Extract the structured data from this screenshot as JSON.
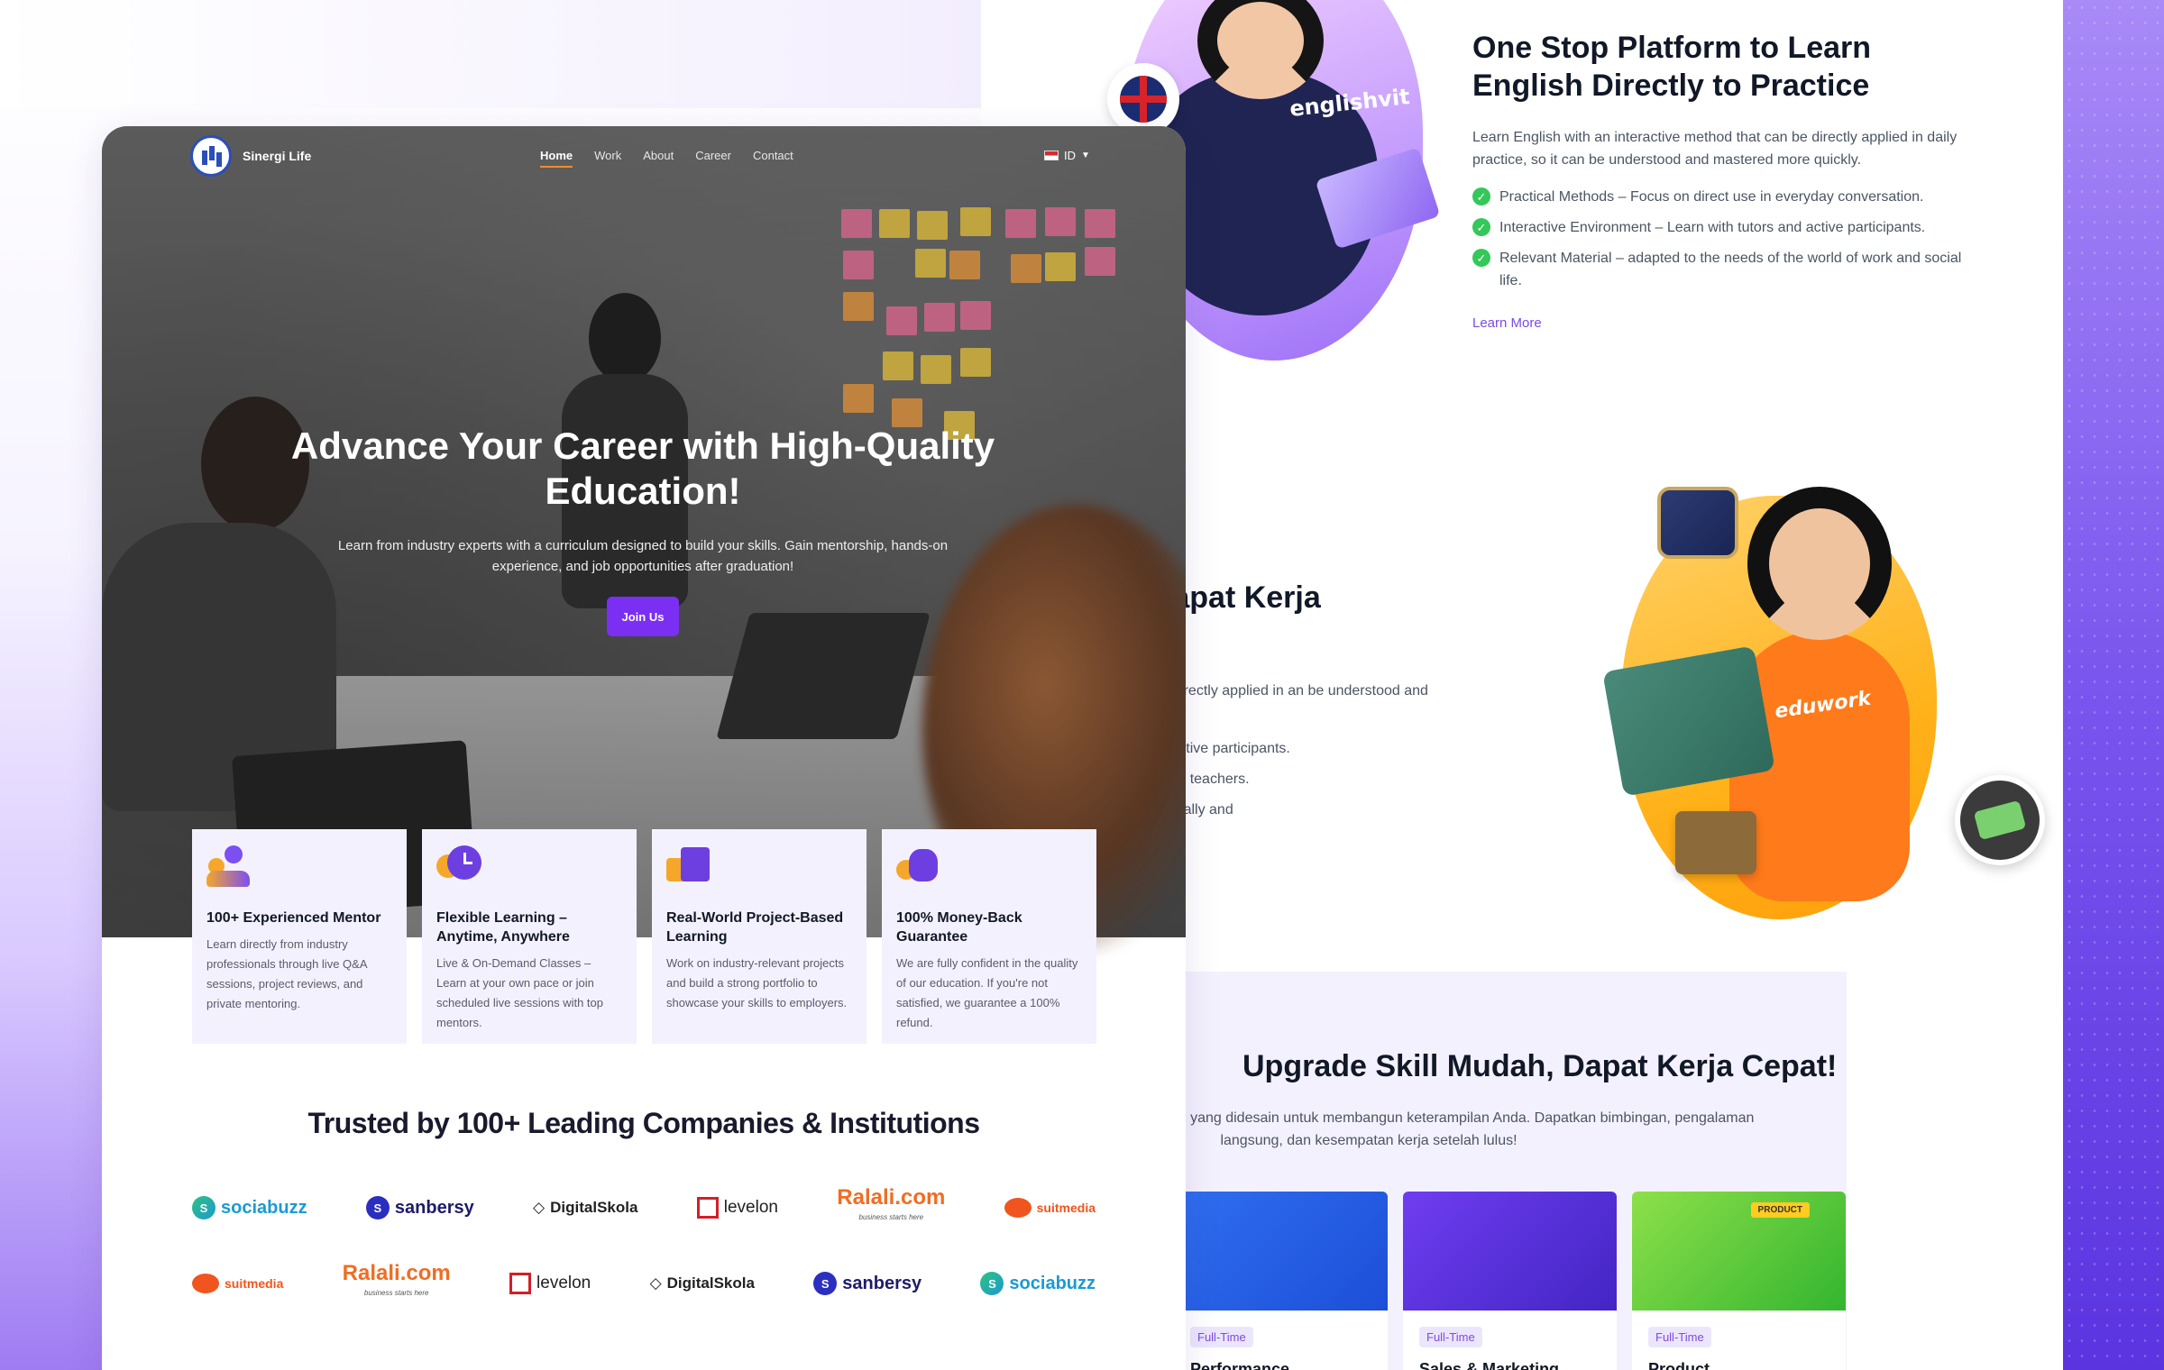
{
  "main": {
    "brand": "Sinergi Life",
    "nav": [
      "Home",
      "Work",
      "About",
      "Career",
      "Contact"
    ],
    "lang": "ID",
    "hero_title": "Advance Your Career with High-Quality Education!",
    "hero_sub": "Learn from industry experts with a curriculum designed to build your skills. Gain mentorship, hands-on experience, and job opportunities after graduation!",
    "join_label": "Join Us",
    "features": [
      {
        "title": "100+ Experienced Mentor",
        "desc": "Learn directly from industry professionals through live Q&A sessions, project reviews, and private mentoring.",
        "icon": "mentor-icon"
      },
      {
        "title": "Flexible Learning – Anytime, Anywhere",
        "desc": "Live & On-Demand Classes – Learn at your own pace or join scheduled live sessions with top mentors.",
        "icon": "clock-icon"
      },
      {
        "title": "Real-World Project-Based Learning",
        "desc": "Work on industry-relevant projects and build a strong portfolio to showcase your skills to employers.",
        "icon": "project-icon"
      },
      {
        "title": "100% Money-Back Guarantee",
        "desc": "We are fully confident in the quality of our education. If you're not satisfied, we guarantee a 100% refund.",
        "icon": "moneybag-icon"
      }
    ],
    "trusted_title": "Trusted by 100+ Leading Companies & Institutions",
    "logos_row1": [
      "sociabuzz",
      "sanbersy",
      "DigitalSkola",
      "levelon",
      "Ralali.com",
      "suitmedia"
    ],
    "logos_row2": [
      "suitmedia",
      "Ralali.com",
      "levelon",
      "DigitalSkola",
      "sanbersy",
      "sociabuzz"
    ],
    "ralali_tagline": "business starts here",
    "englishvit_shirt": "englishvit"
  },
  "right": {
    "block1_title": "One Stop Platform to Learn English Directly to Practice",
    "block1_desc": "Learn English with an interactive method that can be directly applied in daily practice, so it can be understood and mastered more quickly.",
    "block1_checks": [
      "Practical Methods – Focus on direct use in everyday conversation.",
      "Interactive Environment – Learn with tutors and active participants.",
      "Relevant Material – adapted to the needs of the world of work and social life."
    ],
    "learn_more": "Learn More",
    "block2_partial_k": "k",
    "block2_partial_title": "Skill Mudah, Dapat Kerja",
    "block2_partial_desc": "n interactive method that can be directly applied in an be understood and mastered more quickly.",
    "block2_partial_list": [
      "ronment – Learn with tutors and active participants.",
      "ntoring – Mentored by experienced teachers.",
      "Improve your ability to speak naturally and"
    ],
    "shirt_text": "eduwork",
    "upgrade_title": "Upgrade Skill Mudah, Dapat Kerja Cepat!",
    "upgrade_desc": "a ahli industri dengan kurikulum yang didesain untuk membangun keterampilan Anda. Dapatkan bimbingan, pengalaman langsung, dan kesempatan kerja setelah lulus!",
    "jobs": [
      {
        "tag": "",
        "title": ""
      },
      {
        "tag": "Full-Time",
        "title": "Performance"
      },
      {
        "tag": "Full-Time",
        "title": "Sales & Marketing"
      },
      {
        "tag": "Full-Time",
        "title": "Product"
      }
    ],
    "product_badge": "PRODUCT"
  },
  "colors": {
    "accent": "#7b2ff2",
    "nav_underline": "#ff8a2a",
    "feature_bg": "#f4f1fe",
    "check_green": "#34c759",
    "link_purple": "#7c4ae6"
  }
}
